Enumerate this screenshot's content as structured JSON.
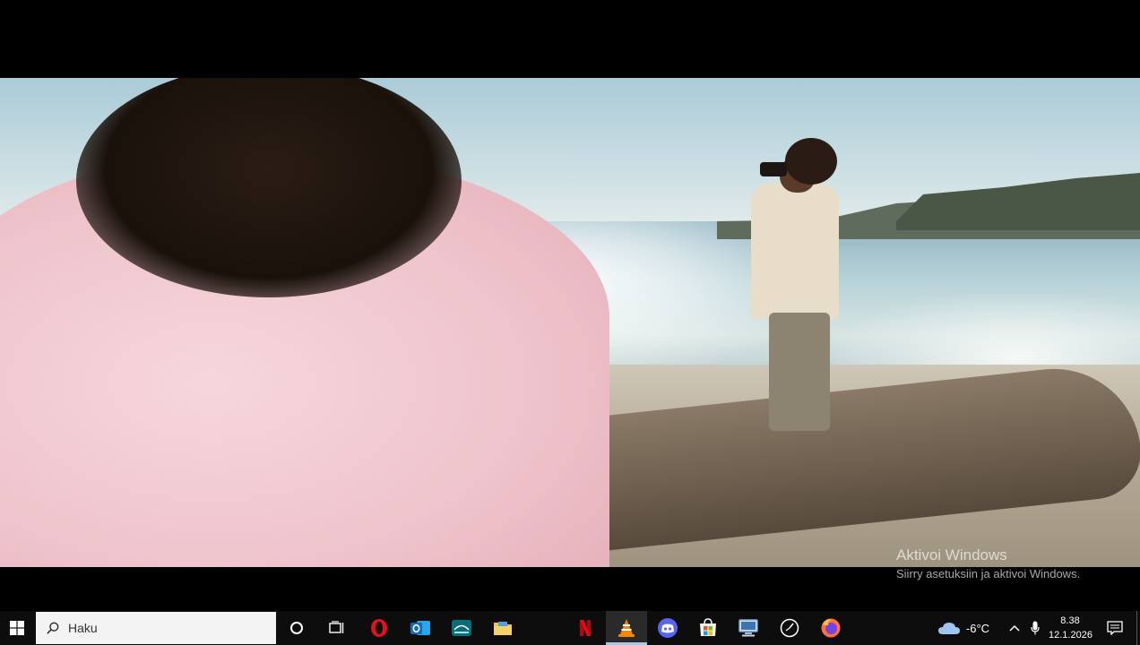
{
  "watermark": {
    "title": "Aktivoi Windows",
    "subtitle": "Siirry asetuksiin ja aktivoi Windows."
  },
  "taskbar": {
    "start_icon": "windows-logo-icon",
    "search_placeholder": "Haku",
    "apps": [
      {
        "name": "cortana",
        "icon": "cortana-circle-icon",
        "color": "#ffffff"
      },
      {
        "name": "task-view",
        "icon": "task-view-icon",
        "color": "#ffffff"
      },
      {
        "name": "opera",
        "icon": "opera-icon",
        "color": "#e0121b"
      },
      {
        "name": "outlook",
        "icon": "outlook-icon",
        "color": "#0f6cbd"
      },
      {
        "name": "disney-plus",
        "icon": "disney-plus-icon",
        "color": "#0a6e7a"
      },
      {
        "name": "file-explorer",
        "icon": "folder-icon",
        "color": "#f2c14e"
      },
      {
        "name": "netflix",
        "icon": "netflix-icon",
        "color": "#e50914"
      },
      {
        "name": "vlc",
        "icon": "vlc-cone-icon",
        "color": "#f08a00",
        "active": true
      },
      {
        "name": "discord",
        "icon": "discord-icon",
        "color": "#5865f2"
      },
      {
        "name": "microsoft-store",
        "icon": "store-icon",
        "color": "#ffffff"
      },
      {
        "name": "remote-desktop",
        "icon": "computer-icon",
        "color": "#7aa7d6"
      },
      {
        "name": "clock-app",
        "icon": "clock-icon",
        "color": "#ffffff"
      },
      {
        "name": "firefox",
        "icon": "firefox-icon",
        "color": "#ff7139"
      }
    ],
    "weather": {
      "temp": "-6°C",
      "icon": "cloud-icon"
    },
    "clock": {
      "time": "8.38",
      "date": "12.1.2026"
    }
  }
}
